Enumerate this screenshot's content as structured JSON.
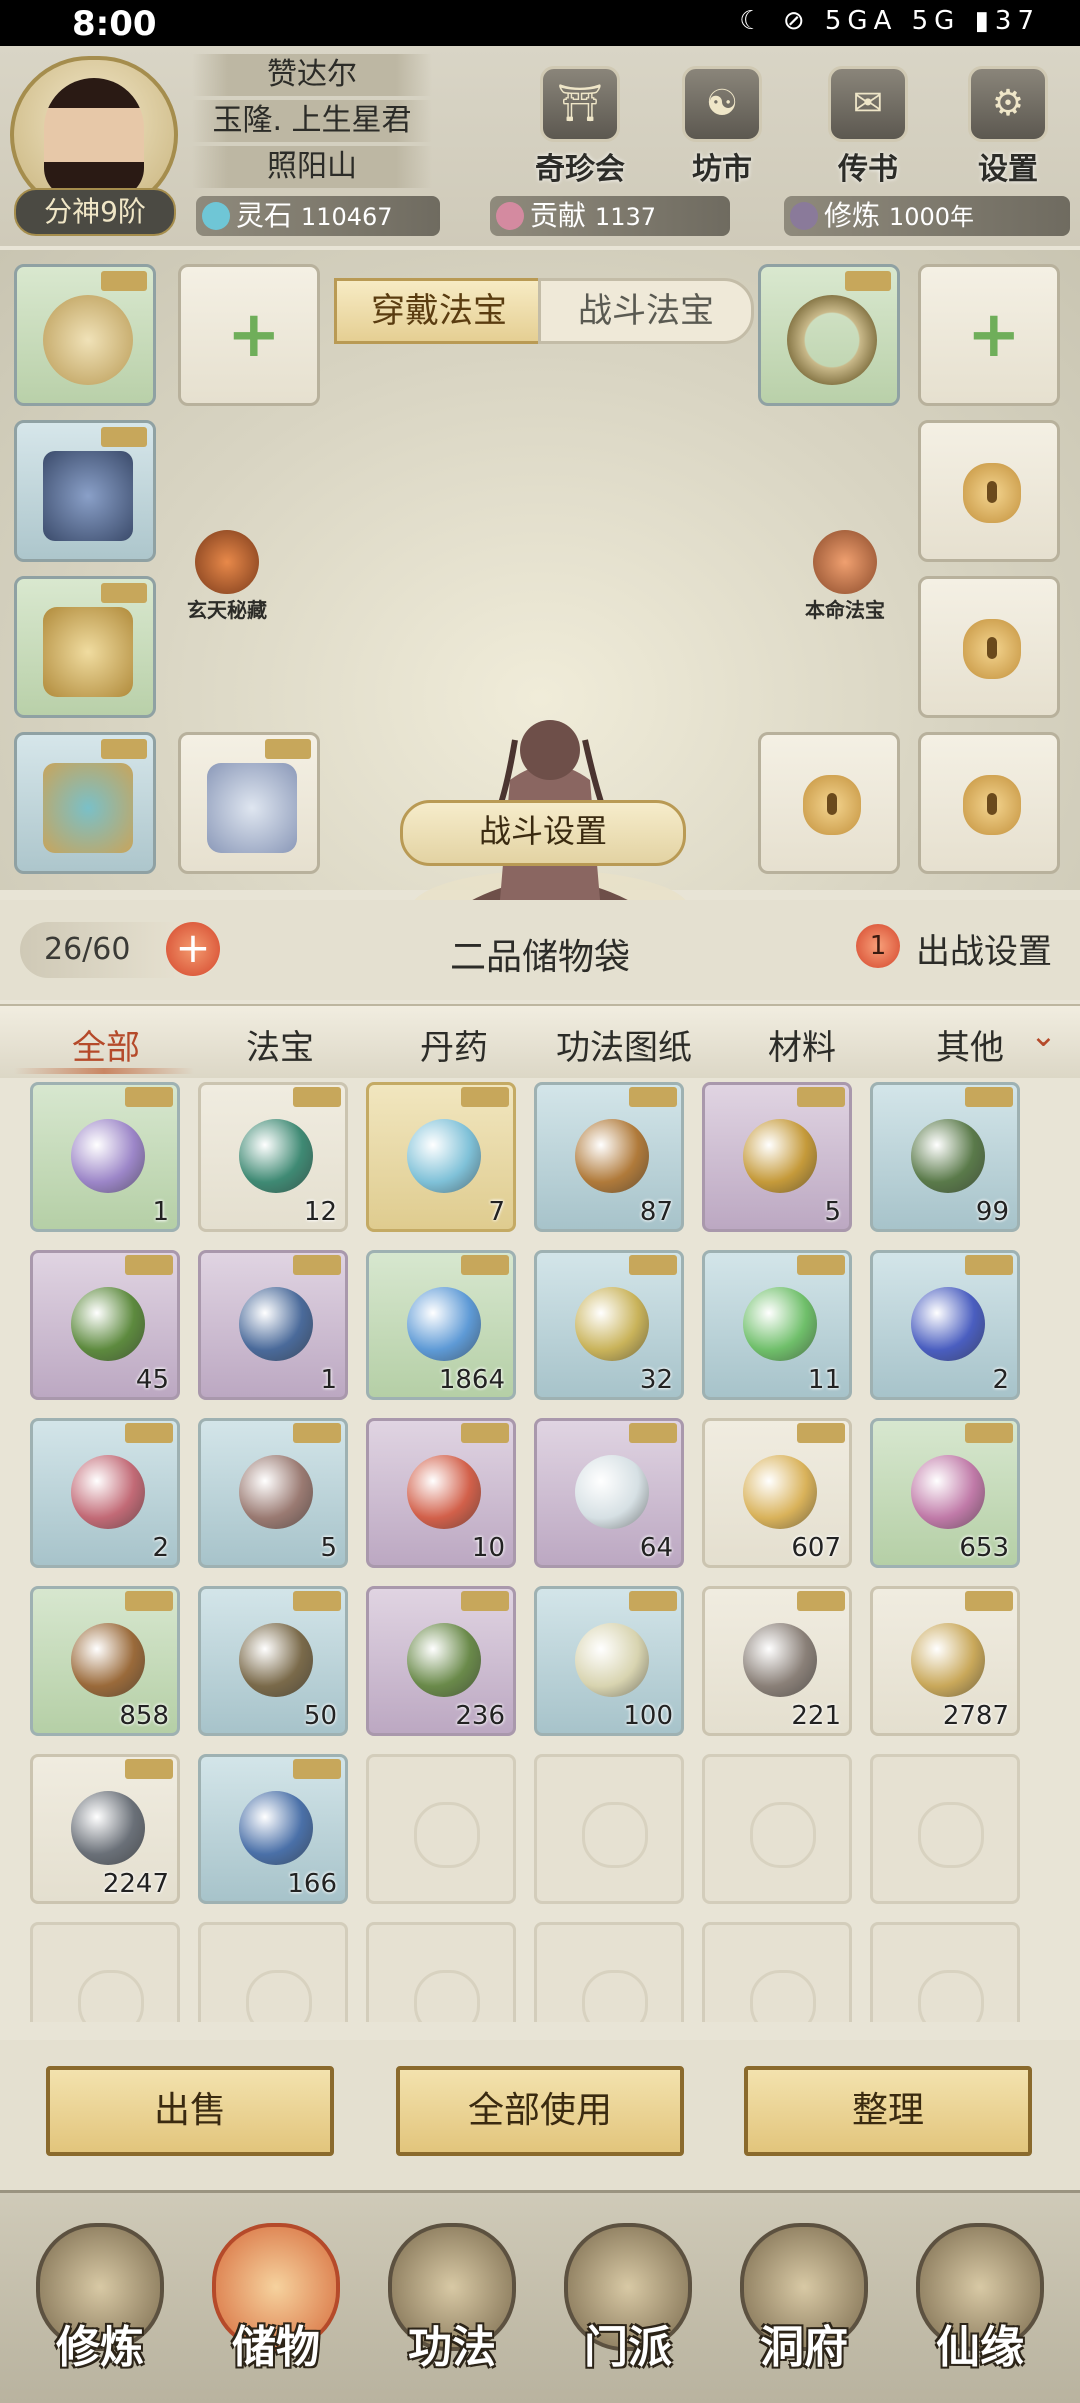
{
  "status_bar": {
    "time": "8:00",
    "network": "5GA 5G",
    "battery": "37"
  },
  "player": {
    "name": "赞达尔",
    "title": "玉隆. 上生星君",
    "sect": "照阳山",
    "rank": "分神9阶"
  },
  "top_menu": [
    {
      "label": "奇珍会",
      "icon": "treasure-shop-icon"
    },
    {
      "label": "坊市",
      "icon": "market-icon"
    },
    {
      "label": "传书",
      "icon": "scroll-mail-icon"
    },
    {
      "label": "设置",
      "icon": "gear-icon"
    }
  ],
  "resources": {
    "spirit_stone": {
      "label": "灵石",
      "value": "110467"
    },
    "contribution": {
      "label": "贡献",
      "value": "1137"
    },
    "cultivation": {
      "label": "修炼",
      "value": "1000年"
    }
  },
  "equip_tabs": {
    "wear": "穿戴法宝",
    "battle": "战斗法宝"
  },
  "side_emblems": {
    "left": "玄天秘藏",
    "right": "本命法宝"
  },
  "battle_settings": "战斗设置",
  "bag": {
    "capacity": "26/60",
    "title": "二品储物袋",
    "deploy_count": "1",
    "deploy_label": "出战设置"
  },
  "categories": [
    "全部",
    "法宝",
    "丹药",
    "功法图纸",
    "材料",
    "其他"
  ],
  "items": [
    {
      "qty": "1",
      "rarity": "green",
      "color": "#9c86c8"
    },
    {
      "qty": "12",
      "rarity": "plain",
      "color": "#3f8a74"
    },
    {
      "qty": "7",
      "rarity": "gold",
      "color": "#7fc1d8"
    },
    {
      "qty": "87",
      "rarity": "blue",
      "color": "#b07a3a"
    },
    {
      "qty": "5",
      "rarity": "purple",
      "color": "#c59a3a"
    },
    {
      "qty": "99",
      "rarity": "blue",
      "color": "#5a7a4a"
    },
    {
      "qty": "45",
      "rarity": "purple",
      "color": "#5d8a3e"
    },
    {
      "qty": "1",
      "rarity": "purple",
      "color": "#4a6a9a"
    },
    {
      "qty": "1864",
      "rarity": "green",
      "color": "#5e9ad6"
    },
    {
      "qty": "32",
      "rarity": "blue",
      "color": "#c9b35a"
    },
    {
      "qty": "11",
      "rarity": "blue",
      "color": "#6fbf6a"
    },
    {
      "qty": "2",
      "rarity": "blue",
      "color": "#4a5ec0"
    },
    {
      "qty": "2",
      "rarity": "blue",
      "color": "#c26a76"
    },
    {
      "qty": "5",
      "rarity": "blue",
      "color": "#9a7a72"
    },
    {
      "qty": "10",
      "rarity": "purple",
      "color": "#d2604a"
    },
    {
      "qty": "64",
      "rarity": "purple",
      "color": "#d6e0e4"
    },
    {
      "qty": "607",
      "rarity": "plain",
      "color": "#d9b25a"
    },
    {
      "qty": "653",
      "rarity": "green",
      "color": "#c07aa8"
    },
    {
      "qty": "858",
      "rarity": "green",
      "color": "#9a6a3a"
    },
    {
      "qty": "50",
      "rarity": "blue",
      "color": "#7a6a4a"
    },
    {
      "qty": "236",
      "rarity": "purple",
      "color": "#6a8a4a"
    },
    {
      "qty": "100",
      "rarity": "blue",
      "color": "#d8d4b0"
    },
    {
      "qty": "221",
      "rarity": "plain",
      "color": "#8a8078"
    },
    {
      "qty": "2787",
      "rarity": "plain",
      "color": "#c9a85a"
    },
    {
      "qty": "2247",
      "rarity": "plain",
      "color": "#6a7078"
    },
    {
      "qty": "166",
      "rarity": "blue",
      "color": "#4a70a8"
    }
  ],
  "actions": {
    "sell": "出售",
    "use_all": "全部使用",
    "sort": "整理"
  },
  "bottom_nav": [
    {
      "label": "修炼",
      "active": false
    },
    {
      "label": "储物",
      "active": true
    },
    {
      "label": "功法",
      "active": false
    },
    {
      "label": "门派",
      "active": false
    },
    {
      "label": "洞府",
      "active": false
    },
    {
      "label": "仙缘",
      "active": false
    }
  ]
}
